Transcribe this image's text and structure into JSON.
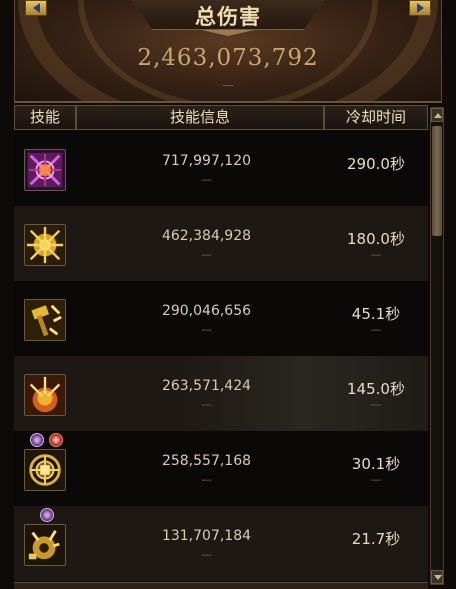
{
  "banner": {
    "title": "总伤害",
    "total_damage": "2,463,073,792",
    "dash": "—"
  },
  "table": {
    "headers": {
      "skill": "技能",
      "info": "技能信息",
      "cooldown": "冷却时间"
    },
    "rows": [
      {
        "icon": "purple-rune-skill-icon",
        "damage": "717,997,120",
        "dash": "—",
        "cooldown": "290.0秒",
        "cd_dash": ""
      },
      {
        "icon": "golden-burst-skill-icon",
        "damage": "462,384,928",
        "dash": "—",
        "cooldown": "180.0秒",
        "cd_dash": "—"
      },
      {
        "icon": "golden-hammer-skill-icon",
        "damage": "290,046,656",
        "dash": "—",
        "cooldown": "45.1秒",
        "cd_dash": "—"
      },
      {
        "icon": "golden-explosion-skill-icon",
        "damage": "263,571,424",
        "dash": "—",
        "cooldown": "145.0秒",
        "cd_dash": "—"
      },
      {
        "icon": "golden-wheel-skill-icon",
        "damage": "258,557,168",
        "dash": "—",
        "cooldown": "30.1秒",
        "cd_dash": "—"
      },
      {
        "icon": "golden-gear-skill-icon",
        "damage": "131,707,184",
        "dash": "—",
        "cooldown": "21.7秒",
        "cd_dash": ""
      }
    ]
  },
  "colors": {
    "gold_text": "#c9a86c",
    "header_border": "#5e4e36",
    "nav_button": "#e6c66a"
  }
}
